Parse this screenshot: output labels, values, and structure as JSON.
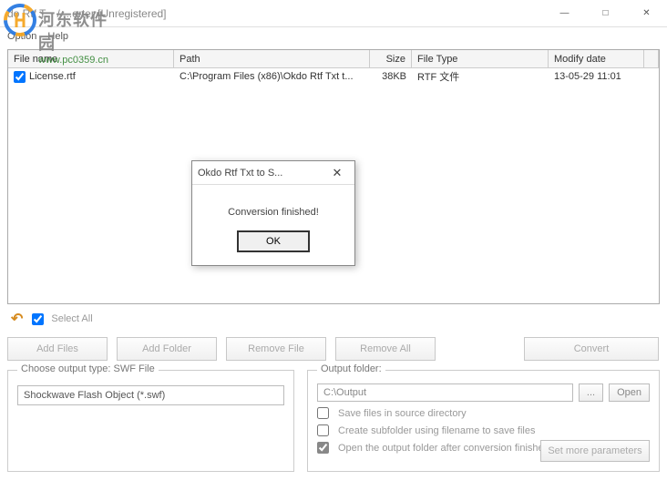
{
  "window": {
    "title": "do Rtf T... / ...erter [Unregistered]",
    "minimize": "—",
    "maximize": "□",
    "close": "✕"
  },
  "menu": {
    "option": "Option",
    "help": "Help"
  },
  "watermark": {
    "cn": "河东软件园",
    "url": "www.pc0359.cn"
  },
  "grid": {
    "headers": {
      "fname": "File name",
      "path": "Path",
      "size": "Size",
      "ftype": "File Type",
      "mdate": "Modify date"
    },
    "rows": [
      {
        "checked": true,
        "fname": "License.rtf",
        "path": "C:\\Program Files (x86)\\Okdo Rtf Txt t...",
        "size": "38KB",
        "ftype": "RTF 文件",
        "mdate": "13-05-29 11:01"
      }
    ]
  },
  "toolbar": {
    "selectall": "Select All"
  },
  "buttons": {
    "addfiles": "Add Files",
    "addfolder": "Add Folder",
    "removefile": "Remove File",
    "removeall": "Remove All",
    "convert": "Convert"
  },
  "outtype": {
    "label": "Choose output type:  SWF File",
    "value": "Shockwave Flash Object (*.swf)"
  },
  "outfolder": {
    "label": "Output folder:",
    "value": "C:\\Output",
    "browse": "...",
    "open": "Open",
    "opt1": "Save files in source directory",
    "opt2": "Create subfolder using filename to save files",
    "opt3": "Open the output folder after conversion finished",
    "setmore": "Set more parameters"
  },
  "dialog": {
    "title": "Okdo Rtf Txt to S...",
    "message": "Conversion finished!",
    "ok": "OK"
  }
}
